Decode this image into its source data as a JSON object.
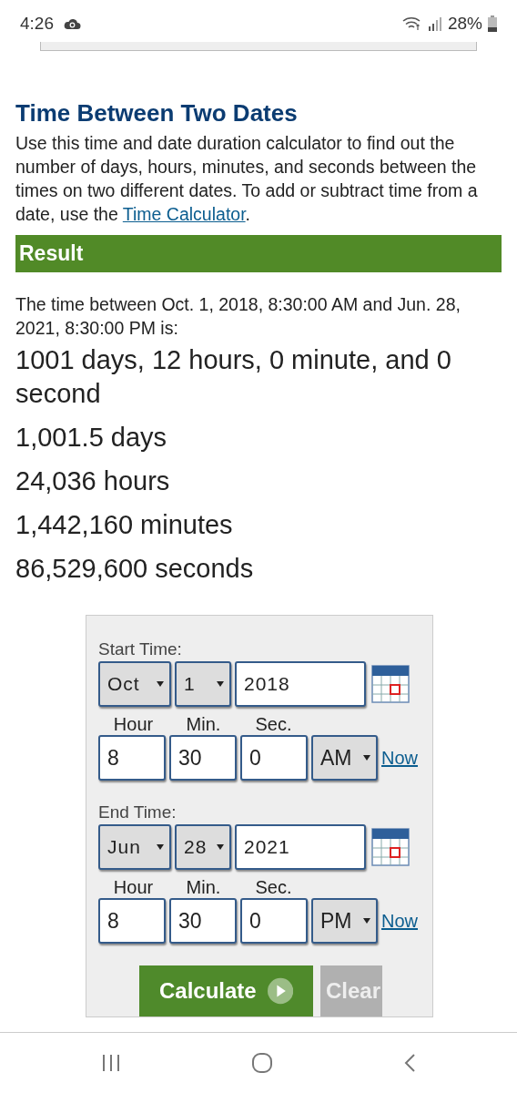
{
  "status_bar": {
    "time": "4:26",
    "battery": "28%"
  },
  "title": "Time Between Two Dates",
  "intro": "Use this time and date duration calculator to find out the number of days, hours, minutes, and seconds between the times on two different dates. To add or subtract time from a date, use the ",
  "intro_link": "Time Calculator",
  "intro_end": ".",
  "result": {
    "heading": "Result",
    "summary": "The time between Oct. 1, 2018, 8:30:00 AM and Jun. 28, 2021, 8:30:00 PM is:",
    "lines": [
      "1001 days, 12 hours, 0 minute, and 0 second",
      "1,001.5 days",
      "24,036 hours",
      "1,442,160 minutes",
      "86,529,600 seconds"
    ]
  },
  "form": {
    "times": [
      {
        "label": "Start Time:",
        "month": "Oct",
        "day": "1",
        "year": "2018",
        "hour_label": "Hour",
        "min_label": "Min.",
        "sec_label": "Sec.",
        "hour": "8",
        "minute": "30",
        "second": "0",
        "ampm": "AM",
        "now_link": "Now"
      },
      {
        "label": "End Time:",
        "month": "Jun",
        "day": "28",
        "year": "2021",
        "hour_label": "Hour",
        "min_label": "Min.",
        "sec_label": "Sec.",
        "hour": "8",
        "minute": "30",
        "second": "0",
        "ampm": "PM",
        "now_link": "Now"
      }
    ],
    "buttons": [
      {
        "kind": "primary",
        "label": "Calculate"
      },
      {
        "kind": "secondary",
        "label": "Clear"
      }
    ]
  }
}
